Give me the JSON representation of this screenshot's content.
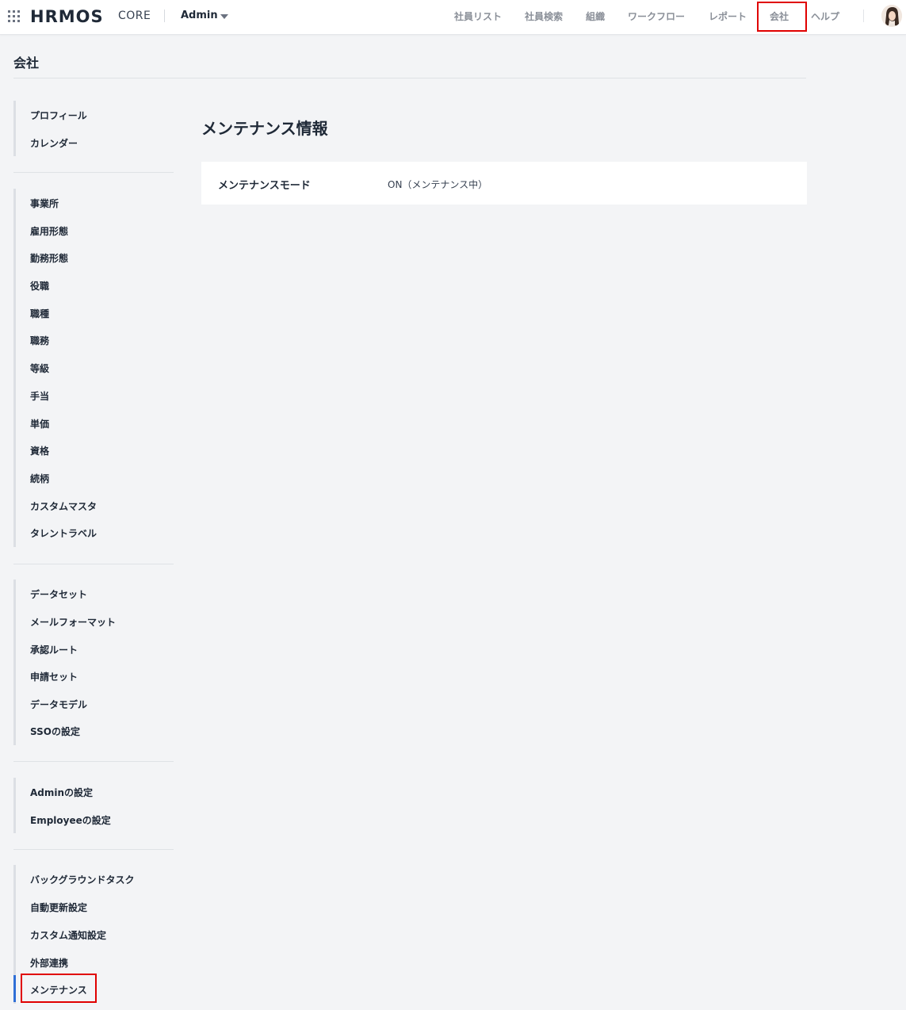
{
  "header": {
    "logo": "HRMOS",
    "product": "CORE",
    "tenant": "Admin",
    "nav": [
      {
        "label": "社員リスト"
      },
      {
        "label": "社員検索"
      },
      {
        "label": "組織"
      },
      {
        "label": "ワークフロー"
      },
      {
        "label": "レポート"
      },
      {
        "label": "会社",
        "selected": true
      },
      {
        "label": "ヘルプ"
      }
    ]
  },
  "page": {
    "title": "会社"
  },
  "sidebar": {
    "groups": [
      {
        "items": [
          "プロフィール",
          "カレンダー"
        ]
      },
      {
        "items": [
          "事業所",
          "雇用形態",
          "勤務形態",
          "役職",
          "職種",
          "職務",
          "等級",
          "手当",
          "単価",
          "資格",
          "続柄",
          "カスタムマスタ",
          "タレントラベル"
        ]
      },
      {
        "items": [
          "データセット",
          "メールフォーマット",
          "承認ルート",
          "申請セット",
          "データモデル",
          "SSOの設定"
        ]
      },
      {
        "items": [
          "Adminの設定",
          "Employeeの設定"
        ]
      },
      {
        "items": [
          "バックグラウンドタスク",
          "自動更新設定",
          "カスタム通知設定",
          "外部連携",
          "メンテナンス"
        ]
      }
    ],
    "active": "メンテナンス",
    "active_color": "#2f6fd6"
  },
  "main": {
    "title": "メンテナンス情報",
    "rows": [
      {
        "label": "メンテナンスモード",
        "value": "ON（メンテナンス中）"
      }
    ]
  },
  "highlight_color": "#e00000"
}
